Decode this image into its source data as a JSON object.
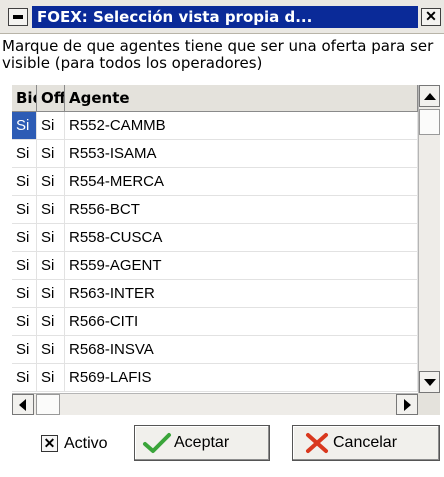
{
  "window": {
    "title": "FOEX: Selección vista propia d...",
    "close_glyph": "✕",
    "sysmenu_icon": "window-menu-icon"
  },
  "description": "Marque de que agentes tiene que ser una oferta para ser visible (para todos los operadores)",
  "table": {
    "columns": [
      "Bid",
      "Off",
      "Agente"
    ],
    "rows": [
      {
        "bid": "Si",
        "off": "Si",
        "agente": "R552-CAMMB",
        "selected": true
      },
      {
        "bid": "Si",
        "off": "Si",
        "agente": "R553-ISAMA"
      },
      {
        "bid": "Si",
        "off": "Si",
        "agente": "R554-MERCA"
      },
      {
        "bid": "Si",
        "off": "Si",
        "agente": "R556-BCT"
      },
      {
        "bid": "Si",
        "off": "Si",
        "agente": "R558-CUSCA"
      },
      {
        "bid": "Si",
        "off": "Si",
        "agente": "R559-AGENT"
      },
      {
        "bid": "Si",
        "off": "Si",
        "agente": "R563-INTER"
      },
      {
        "bid": "Si",
        "off": "Si",
        "agente": "R566-CITI"
      },
      {
        "bid": "Si",
        "off": "Si",
        "agente": "R568-INSVA"
      },
      {
        "bid": "Si",
        "off": "Si",
        "agente": "R569-LAFIS"
      }
    ],
    "selection_color": "#2d5cb5"
  },
  "footer": {
    "activo_label": "Activo",
    "activo_checked": true,
    "accept_label": "Aceptar",
    "cancel_label": "Cancelar",
    "accept_icon": "checkmark-icon",
    "cancel_icon": "cross-icon",
    "accept_color": "#3aa53a",
    "cancel_color": "#d9381e"
  },
  "colors": {
    "title_bar": "#0a2a98",
    "title_text": "#ffffff"
  }
}
